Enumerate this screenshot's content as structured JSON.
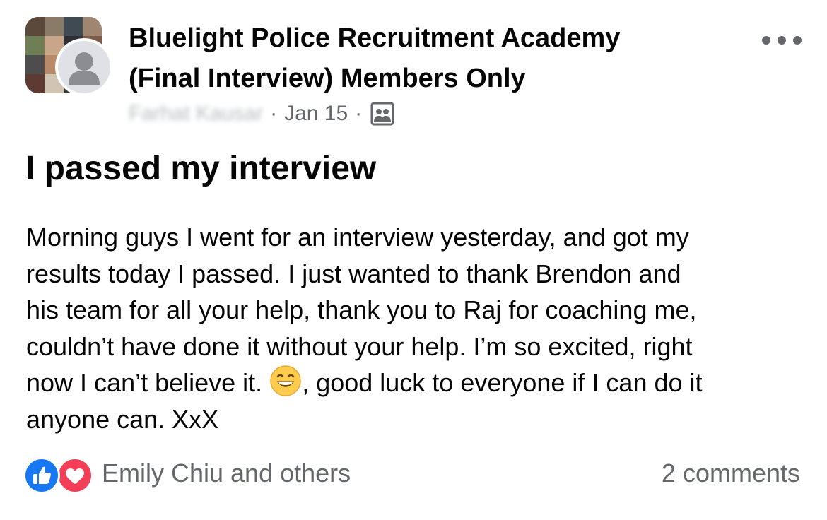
{
  "header": {
    "group_name_line1": "Bluelight Police Recruitment Academy",
    "group_name_line2": "(Final Interview) Members Only",
    "author": "Farhat Kausar",
    "separator": "·",
    "date": "Jan 15",
    "audience_icon": "group-audience-icon",
    "more_icon": "more-options-icon"
  },
  "post": {
    "title": "I passed my interview",
    "body_lines": [
      "Morning guys I went for an interview yesterday, and got my",
      "results today I passed. I just wanted to thank Brendon and",
      "his team for all your help, thank you to Raj for coaching me,",
      "couldn’t have done it without your help. I’m so excited, right",
      "now I can’t believe it. ",
      ", good luck to everyone if I can do it",
      "anyone can. XxX"
    ],
    "emoji": "grinning-face-emoji"
  },
  "footer": {
    "reaction_icons": [
      "like-icon",
      "love-icon"
    ],
    "reactions_text": "Emily Chiu and others",
    "comments_text": "2 comments"
  },
  "colors": {
    "text_primary": "#050505",
    "text_secondary": "#65676b",
    "like_blue": "#1877f2",
    "love_red": "#f33e58",
    "avatar_placeholder": "#dfe1e6"
  }
}
